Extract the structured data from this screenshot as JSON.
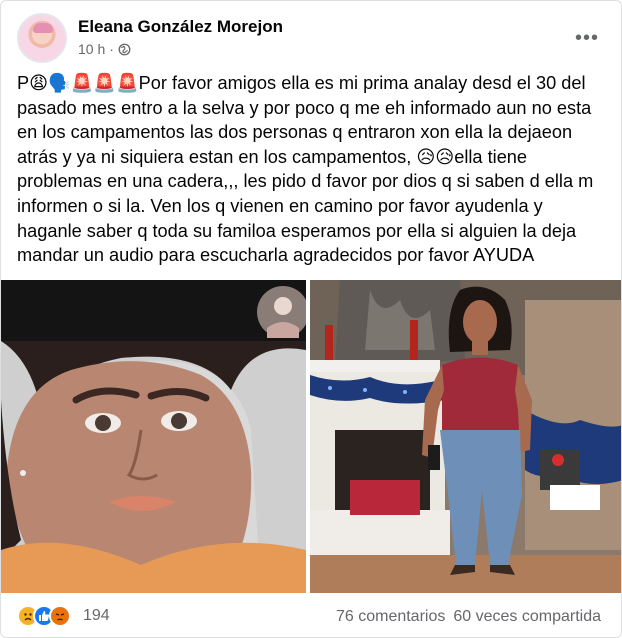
{
  "post": {
    "author": "Eleana González Morejon",
    "time": "10 h",
    "separator": "·",
    "more_label": "•••",
    "text": "P😩🗣️🚨🚨🚨Por favor amigos ella es mi prima analay desd el 30 del pasado mes entro a la selva y por poco q me eh informado aun no esta en los campamentos las dos personas q entraron xon ella la dejaeon atrás y ya ni siquiera estan en los campamentos, 😥😥ella tiene problemas en una cadera,,, les pido d favor por dios q si saben d ella m informen o si la. Ven los q vienen en camino por favor ayudenla y haganle saber q toda su familoa esperamos por ella si alguien la deja mandar un audio para escucharla agradecidos por favor AYUDA"
  },
  "footer": {
    "reaction_count": "194",
    "comments": "76 comentarios",
    "shares": "60 veces compartida"
  },
  "icons": {
    "avatar": "profile-photo",
    "globe": "globe-icon",
    "more": "more-options-icon",
    "reactions": [
      "sad-reaction-icon",
      "like-reaction-icon",
      "angry-reaction-icon"
    ]
  },
  "colors": {
    "secondary_text": "#65676b",
    "like_blue": "#1877f2",
    "sad_yellow": "#f7b125",
    "angry_orange": "#e9710f"
  }
}
